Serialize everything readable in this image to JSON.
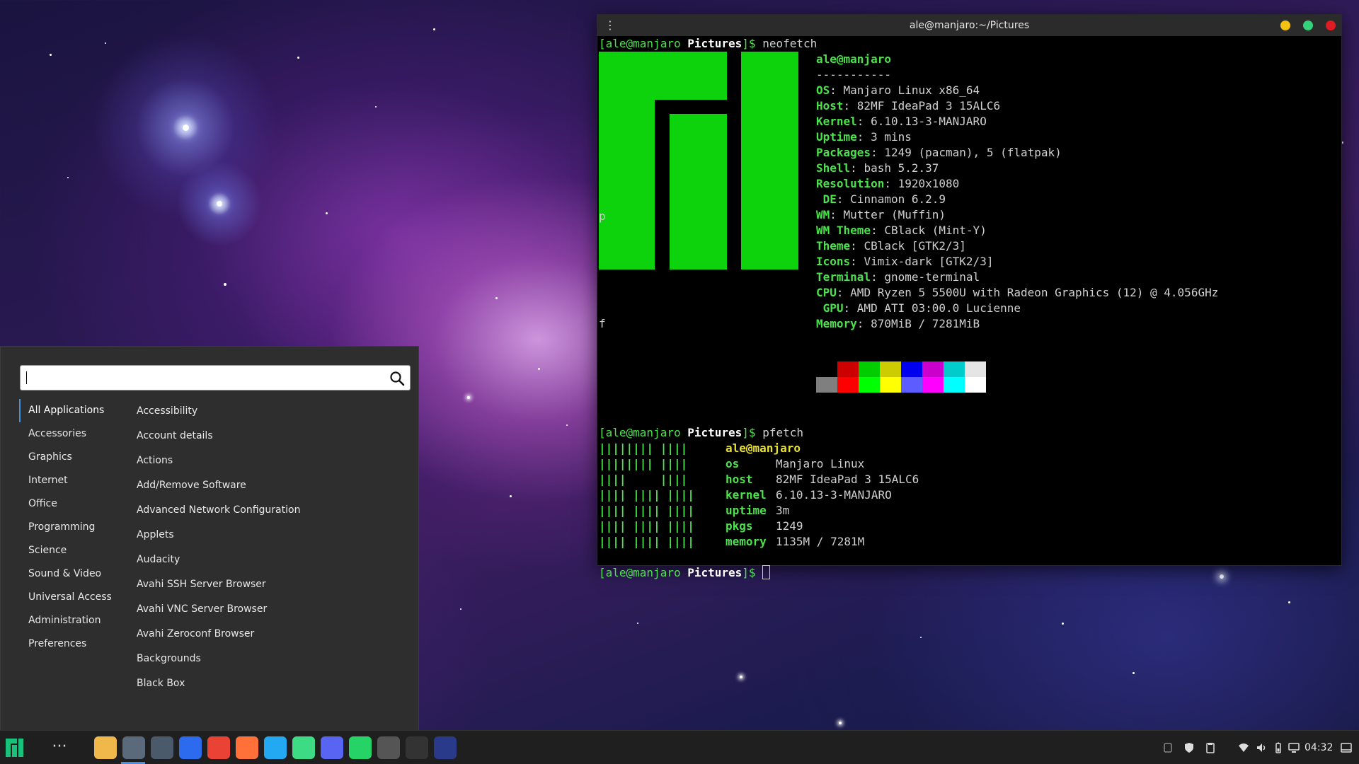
{
  "terminal": {
    "title": "ale@manjaro:~/Pictures",
    "prompt": {
      "user_host": "[ale@manjaro",
      "dir": "Pictures",
      "end": "]$"
    },
    "cmd1": "neofetch",
    "cmd2": "pfetch",
    "stray1": "p",
    "stray2": "f",
    "neofetch": {
      "header": "ale@manjaro",
      "separator": "-----------",
      "rows": [
        {
          "key": "OS",
          "value": "Manjaro Linux x86_64"
        },
        {
          "key": "Host",
          "value": "82MF IdeaPad 3 15ALC6"
        },
        {
          "key": "Kernel",
          "value": "6.10.13-3-MANJARO"
        },
        {
          "key": "Uptime",
          "value": "3 mins"
        },
        {
          "key": "Packages",
          "value": "1249 (pacman), 5 (flatpak)"
        },
        {
          "key": "Shell",
          "value": "bash 5.2.37"
        },
        {
          "key": "Resolution",
          "value": "1920x1080"
        },
        {
          "key": " DE",
          "value": "Cinnamon 6.2.9"
        },
        {
          "key": "WM",
          "value": "Mutter (Muffin)"
        },
        {
          "key": "WM Theme",
          "value": "CBlack (Mint-Y)"
        },
        {
          "key": "Theme",
          "value": "CBlack [GTK2/3]"
        },
        {
          "key": "Icons",
          "value": "Vimix-dark [GTK2/3]"
        },
        {
          "key": "Terminal",
          "value": "gnome-terminal"
        },
        {
          "key": "CPU",
          "value": "AMD Ryzen 5 5500U with Radeon Graphics (12) @ 4.056GHz"
        },
        {
          "key": " GPU",
          "value": "AMD ATI 03:00.0 Lucienne"
        },
        {
          "key": "Memory",
          "value": "870MiB / 7281MiB"
        }
      ],
      "palette_top": [
        "#000000",
        "#cc0000",
        "#00cc00",
        "#cccc00",
        "#0000ee",
        "#cc00cc",
        "#00cccc",
        "#e5e5e5"
      ],
      "palette_bottom": [
        "#7f7f7f",
        "#ff0000",
        "#00ff00",
        "#ffff00",
        "#5c5cff",
        "#ff00ff",
        "#00ffff",
        "#ffffff"
      ]
    },
    "pfetch": {
      "logo": [
        "|||||||| ||||",
        "|||||||| ||||",
        "||||     ||||",
        "|||| |||| ||||",
        "|||| |||| ||||",
        "|||| |||| ||||",
        "|||| |||| ||||"
      ],
      "header": "ale@manjaro",
      "rows": [
        {
          "key": "os",
          "value": "Manjaro Linux"
        },
        {
          "key": "host",
          "value": "82MF IdeaPad 3 15ALC6"
        },
        {
          "key": "kernel",
          "value": "6.10.13-3-MANJARO"
        },
        {
          "key": "uptime",
          "value": "3m"
        },
        {
          "key": "pkgs",
          "value": "1249"
        },
        {
          "key": "memory",
          "value": "1135M / 7281M"
        }
      ]
    }
  },
  "menu": {
    "search": {
      "value": "",
      "placeholder": ""
    },
    "categories": [
      "All Applications",
      "Accessories",
      "Graphics",
      "Internet",
      "Office",
      "Programming",
      "Science",
      "Sound & Video",
      "Universal Access",
      "Administration",
      "Preferences"
    ],
    "apps": [
      "Accessibility",
      "Account details",
      "Actions",
      "Add/Remove Software",
      "Advanced Network Configuration",
      "Applets",
      "Audacity",
      "Avahi SSH Server Browser",
      "Avahi VNC Server Browser",
      "Avahi Zeroconf Browser",
      "Backgrounds",
      "Black Box"
    ]
  },
  "taskbar": {
    "clock": "04:32",
    "apps": [
      {
        "name": "files",
        "color": "#f0b84a"
      },
      {
        "name": "terminal-active",
        "color": "#5a6a7a"
      },
      {
        "name": "terminal-2",
        "color": "#4a5a6a"
      },
      {
        "name": "signal",
        "color": "#2c6bed"
      },
      {
        "name": "chrome",
        "color": "#ea4335"
      },
      {
        "name": "firefox",
        "color": "#ff7139"
      },
      {
        "name": "vscode",
        "color": "#23a9f2"
      },
      {
        "name": "android-studio",
        "color": "#3ddc84"
      },
      {
        "name": "discord",
        "color": "#5865f2"
      },
      {
        "name": "whatsapp",
        "color": "#25d366"
      },
      {
        "name": "cat-app",
        "color": "#555555"
      },
      {
        "name": "obs",
        "color": "#333333"
      },
      {
        "name": "audio-app",
        "color": "#2a3a8a"
      }
    ],
    "accent": "#4a90d9"
  }
}
